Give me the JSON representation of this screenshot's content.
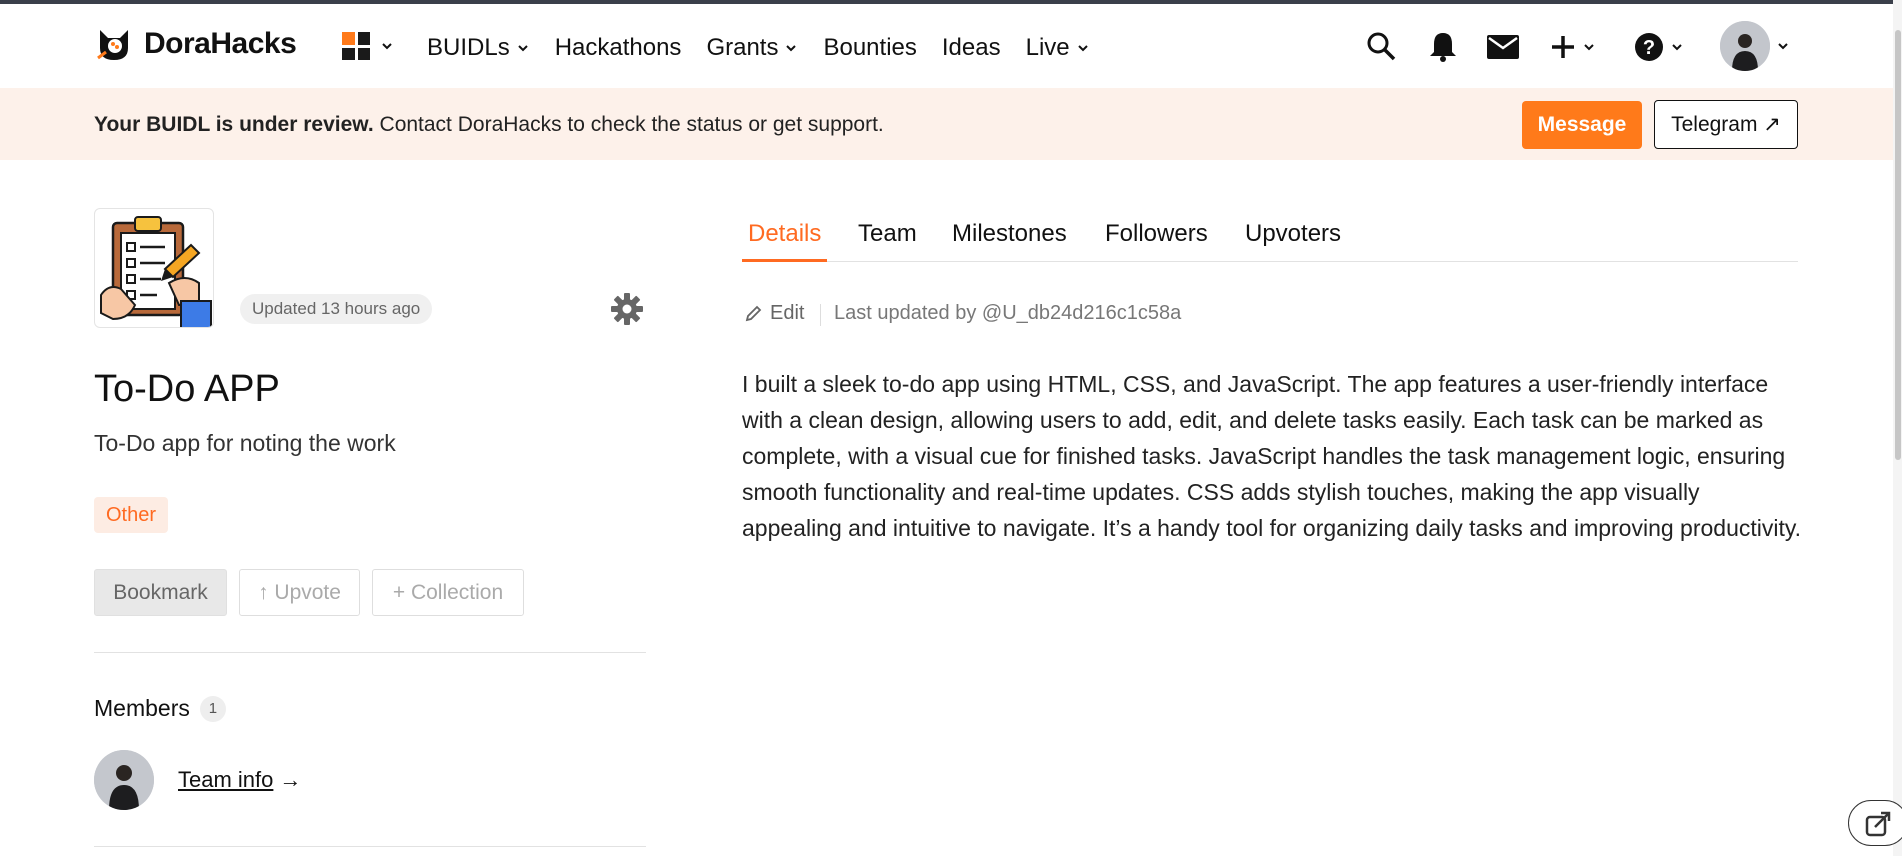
{
  "brand": {
    "name": "DoraHacks",
    "accent": "#ff7a1a"
  },
  "nav": {
    "items": [
      {
        "label": "BUIDLs",
        "dropdown": true
      },
      {
        "label": "Hackathons",
        "dropdown": false
      },
      {
        "label": "Grants",
        "dropdown": true
      },
      {
        "label": "Bounties",
        "dropdown": false
      },
      {
        "label": "Ideas",
        "dropdown": false
      },
      {
        "label": "Live",
        "dropdown": true
      }
    ],
    "icons": [
      "apps-grid-icon",
      "search-icon",
      "bell-icon",
      "mail-icon",
      "plus-icon",
      "help-icon",
      "avatar"
    ]
  },
  "banner": {
    "bold": "Your BUIDL is under review.",
    "text": " Contact DoraHacks to check the status or get support.",
    "message_button": "Message",
    "telegram_button": "Telegram ↗"
  },
  "project": {
    "updated": "Updated 13 hours ago",
    "title": "To-Do APP",
    "subtitle": "To-Do app for noting the work",
    "tag": "Other",
    "bookmark": "Bookmark",
    "upvote": "↑ Upvote",
    "collection": "+ Collection",
    "members_label": "Members",
    "members_count": "1",
    "team_info": "Team info",
    "team_arrow": "→"
  },
  "tabs": [
    "Details",
    "Team",
    "Milestones",
    "Followers",
    "Upvoters"
  ],
  "active_tab": "Details",
  "details": {
    "edit": "Edit",
    "last_updated": "Last updated by @U_db24d216c1c58a",
    "description": "I built a sleek to-do app using HTML, CSS, and JavaScript. The app features a user-friendly interface with a clean design, allowing users to add, edit, and delete tasks easily. Each task can be marked as complete, with a visual cue for finished tasks. JavaScript handles the task management logic, ensuring smooth functionality and real-time updates. CSS adds stylish touches, making the app visually appealing and intuitive to navigate. It’s a handy tool for organizing daily tasks and improving productivity."
  }
}
